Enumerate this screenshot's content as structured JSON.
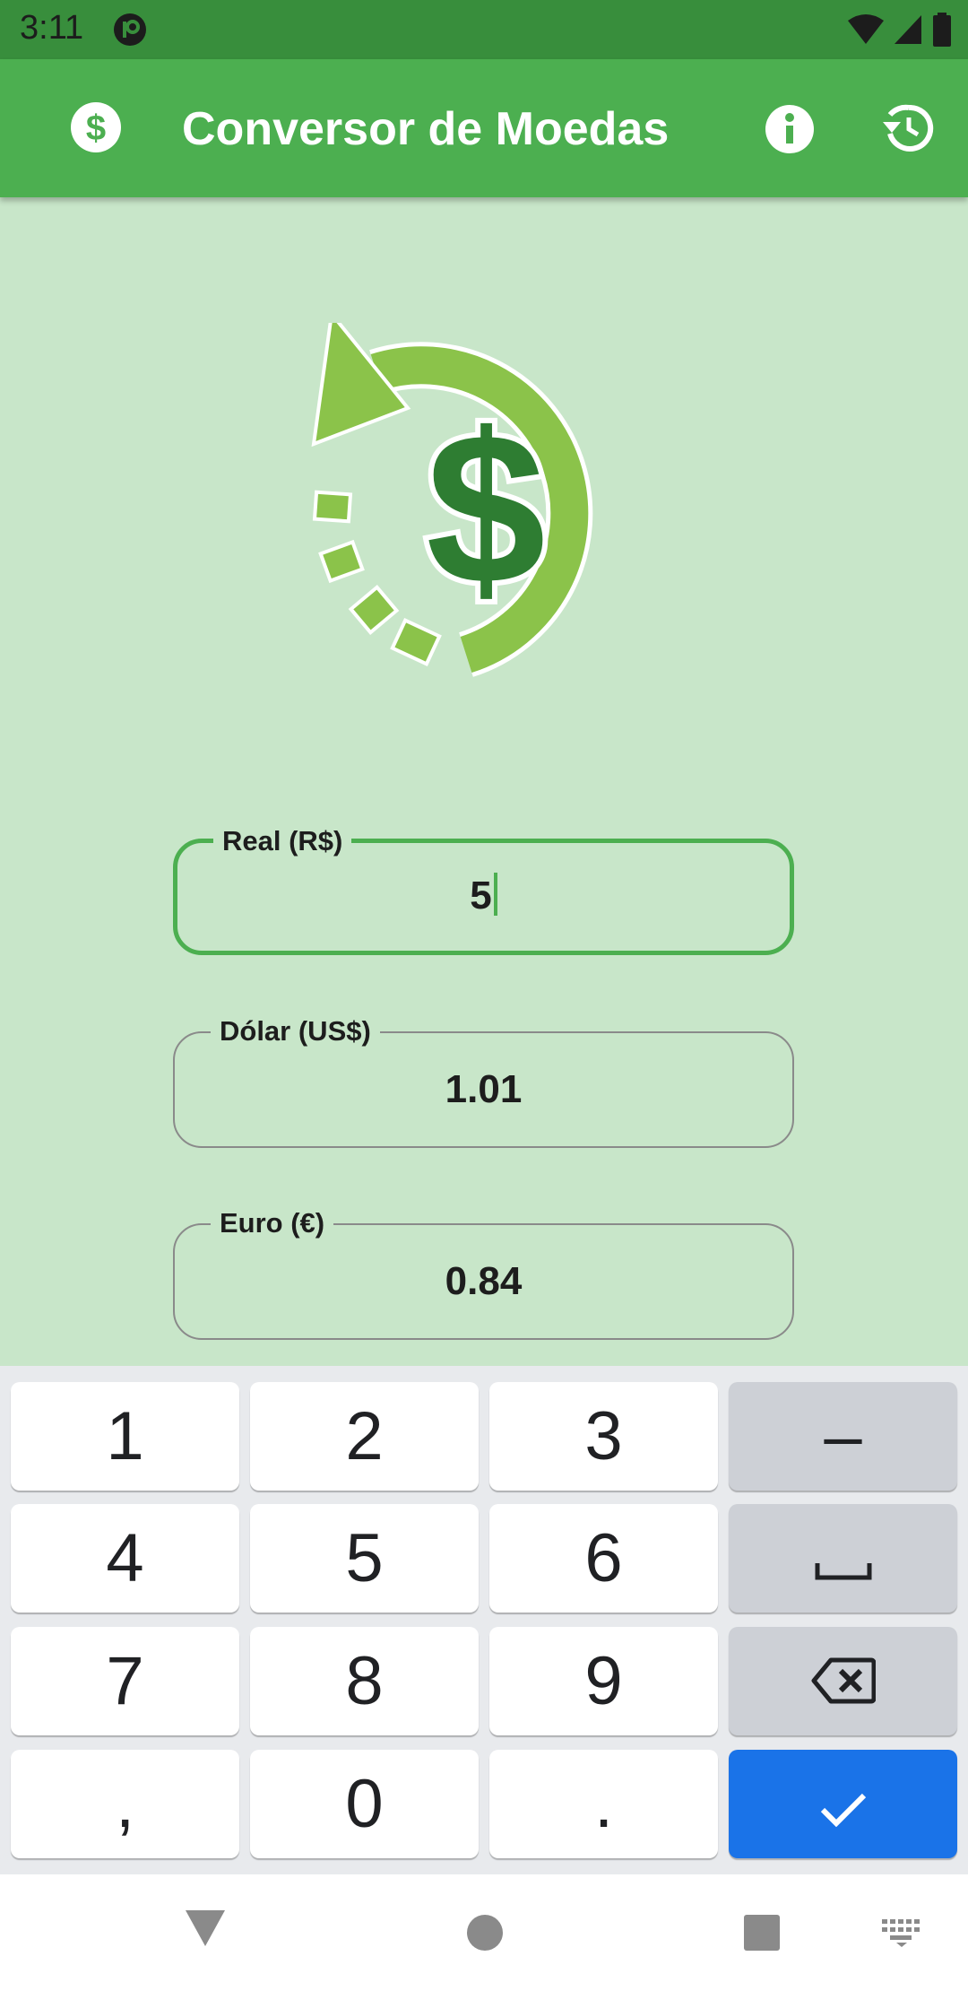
{
  "status_bar": {
    "time": "3:11",
    "icons": [
      "app-notification-icon",
      "wifi-icon",
      "cell-signal-icon",
      "battery-icon"
    ]
  },
  "app_bar": {
    "title": "Conversor de Moedas",
    "icons": [
      "dollar-coin-icon",
      "info-icon",
      "history-icon"
    ],
    "color": "#4caf50"
  },
  "hero": {
    "icon": "currency-exchange-logo"
  },
  "fields": [
    {
      "label": "Real (R$)",
      "value": "5",
      "focused": true
    },
    {
      "label": "Dólar (US$)",
      "value": "1.01",
      "focused": false
    },
    {
      "label": "Euro (€)",
      "value": "0.84",
      "focused": false
    }
  ],
  "keyboard": {
    "keys": {
      "k1": "1",
      "k2": "2",
      "k3": "3",
      "minus": "–",
      "k4": "4",
      "k5": "5",
      "k6": "6",
      "k7": "7",
      "k8": "8",
      "k9": "9",
      "comma": ",",
      "k0": "0",
      "period": "."
    },
    "func_icons": [
      "space-icon",
      "backspace-icon",
      "check-icon"
    ],
    "accent": "#1a73e8"
  },
  "nav_bar": {
    "icons": [
      "back-icon",
      "home-icon",
      "recents-icon",
      "keyboard-switch-icon"
    ]
  }
}
